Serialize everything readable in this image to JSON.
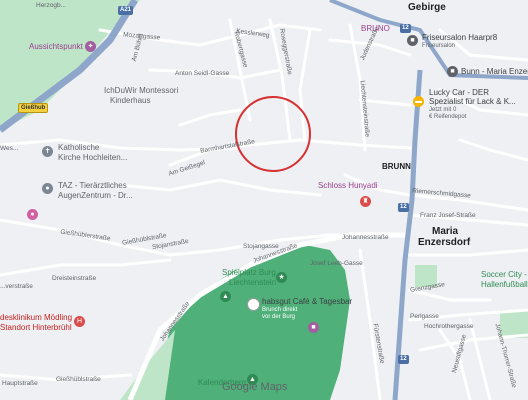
{
  "map": {
    "attribution": "Google Maps",
    "highlight_circle": "selected-area",
    "colors": {
      "background": "#eef0f3",
      "road": "#ffffff",
      "highway": "#8da6c9",
      "park": "#4fb07a",
      "park_light": "#bfe5c9",
      "circle": "#d63031"
    }
  },
  "towns": {
    "gebirge": "Gebirge",
    "brunn": "BRUNN",
    "maria_enzersdorf_1": "Maria",
    "maria_enzersdorf_2": "Enzersdorf"
  },
  "shields": {
    "a21": "A21",
    "b12_top": "12",
    "b12_mid": "12",
    "b12_low": "12",
    "b11": "11",
    "b13": "13",
    "gasthaus": "Gießhub"
  },
  "streets": {
    "herzog": "Herzogb...",
    "mozartgasse": "Mozartgasse",
    "am_buhel": "Am Bühel",
    "kesslerweg": "Kesslerweg",
    "anton_seidl": "Anton Seidl-Gasse",
    "robert": "Robertgasse",
    "roseggerstrasse": "Roseggerstraße",
    "hochst": "Höch...",
    "judenreith": "Judenstraße",
    "liechtenstein": "Liechtensteinstraße",
    "barmhartstal": "Barmhartstalstraße",
    "am_geissegel": "Am Geißegel",
    "riemerschmid": "Riemerschmidgasse",
    "franz_josef": "Franz Josef-Straße",
    "giesshubl1": "Gießhüblerstraße",
    "giesshubl2": "Gießhüblstraße",
    "giesshubl3": "Gießhüblstraße",
    "stojanstrasse": "Stojanstraße",
    "stojangasse": "Stojangasse",
    "johannesstrasse": "Johannesstraße",
    "johannesstrasse2": "Johannesstraße",
    "johannesstrasse3": "Johannesstraße",
    "josef_leeb": "Josef Leeb-Gasse",
    "dreisteinstrasse": "Dreisteinstraße",
    "wertstrasse": "...verstraße",
    "hauptstrasse": "Hauptstraße",
    "grenzgasse": "Grenzgasse",
    "perlgasse": "Perlgasse",
    "hochrotherd": "Hochrothergasse",
    "fuerstenstrasse": "Fürstenstraße",
    "neustiftgasse": "Neustiftgasse",
    "wiener": "Wi...",
    "johann_ilse": "Johann-Thorrer-Straße",
    "theodor": "Theodor...",
    "wes": "Wes..."
  },
  "pois": {
    "aussichtspunkt": "Aussichtspunkt",
    "montessori_1": "IchDuWir Montessori",
    "montessori_2": "Kinderhaus",
    "kirche_1": "Katholische",
    "kirche_2": "Kirche Hochleiten...",
    "taz_1": "TAZ - Tierärztliches",
    "taz_2": "AugenZentrum - Dr...",
    "bruno": "BRUNO",
    "friseur_1": "Friseursalon Haarpr8",
    "friseur_2": "Friseursalon",
    "bunn": "Bunn - Maria Enzersdorf",
    "lucky_1": "Lucky Car - DER",
    "lucky_2": "Spezialist für Lack & K...",
    "lucky_3": "Jetzt mit 0",
    "lucky_4": "€ Reifendepot",
    "schloss": "Schloss Hunyadi",
    "spielplatz_1": "Spielplatz Burg",
    "spielplatz_2": "Liechtenstein",
    "cafe_1": "habsgut Café & Tagesbar",
    "cafe_2": "Brunch direkt",
    "cafe_3": "vor der Burg",
    "soccer_1": "Soccer City -",
    "soccer_2": "Hallenfußball",
    "klinikum_1": "desklinikum Mödling",
    "klinikum_2": "Standort Hinterbrühl",
    "kalenderberg": "Kalenderberg"
  }
}
